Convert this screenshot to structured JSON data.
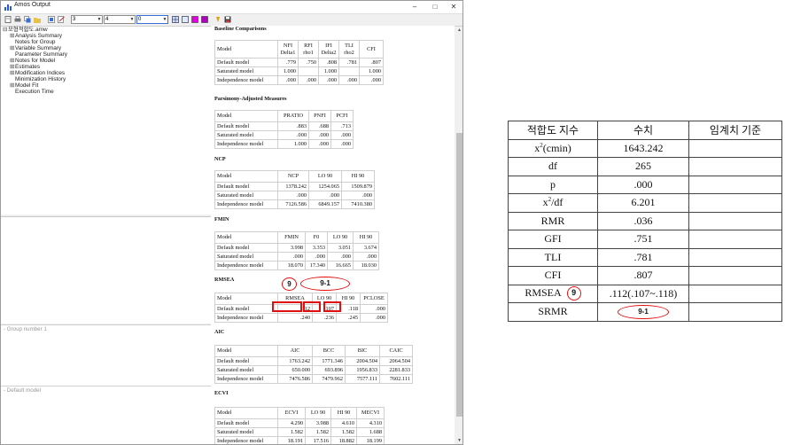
{
  "window": {
    "title": "Amos Output",
    "minimize": "–",
    "maximize": "□",
    "close": "✕"
  },
  "toolbar": {
    "combo1": "3",
    "combo2": "4",
    "combo3": "0"
  },
  "tree": {
    "root": "모형적합도.amw",
    "items": [
      "Analysis Summary",
      "Notes for Group",
      "Variable Summary",
      "Parameter Summary",
      "Notes for Model",
      "Estimates",
      "Modification Indices",
      "Minimization History",
      "Model Fit",
      "Execution Time"
    ]
  },
  "panes": {
    "group": "- Group number 1",
    "model": "- Default model"
  },
  "sections": {
    "baseline": {
      "title": "Baseline Comparisons",
      "header": [
        "Model",
        "NFI\nDelta1",
        "RFI\nrho1",
        "IFI\nDelta2",
        "TLI\nrho2",
        "CFI"
      ],
      "rows": [
        [
          "Default model",
          ".779",
          ".750",
          ".808",
          ".781",
          ".807"
        ],
        [
          "Saturated model",
          "1.000",
          "",
          "1.000",
          "",
          "1.000"
        ],
        [
          "Independence model",
          ".000",
          ".000",
          ".000",
          ".000",
          ".000"
        ]
      ]
    },
    "parsimony": {
      "title": "Parsimony-Adjusted Measures",
      "header": [
        "Model",
        "PRATIO",
        "PNFI",
        "PCFI"
      ],
      "rows": [
        [
          "Default model",
          ".883",
          ".688",
          ".713"
        ],
        [
          "Saturated model",
          ".000",
          ".000",
          ".000"
        ],
        [
          "Independence model",
          "1.000",
          ".000",
          ".000"
        ]
      ]
    },
    "ncp": {
      "title": "NCP",
      "header": [
        "Model",
        "NCP",
        "LO 90",
        "HI 90"
      ],
      "rows": [
        [
          "Default model",
          "1378.242",
          "1254.065",
          "1509.879"
        ],
        [
          "Saturated model",
          ".000",
          ".000",
          ".000"
        ],
        [
          "Independence model",
          "7126.586",
          "6849.157",
          "7410.380"
        ]
      ]
    },
    "fmin": {
      "title": "FMIN",
      "header": [
        "Model",
        "FMIN",
        "F0",
        "LO 90",
        "HI 90"
      ],
      "rows": [
        [
          "Default model",
          "3.998",
          "3.353",
          "3.051",
          "3.674"
        ],
        [
          "Saturated model",
          ".000",
          ".000",
          ".000",
          ".000"
        ],
        [
          "Independence model",
          "18.070",
          "17.340",
          "16.665",
          "18.030"
        ]
      ]
    },
    "rmsea": {
      "title": "RMSEA",
      "header": [
        "Model",
        "RMSEA",
        "LO 90",
        "HI 90",
        "PCLOSE"
      ],
      "rows": [
        [
          "Default model",
          ".112",
          ".107",
          ".118",
          ".000"
        ],
        [
          "Independence model",
          ".240",
          ".236",
          ".245",
          ".000"
        ]
      ]
    },
    "aic": {
      "title": "AIC",
      "header": [
        "Model",
        "AIC",
        "BCC",
        "BIC",
        "CAIC"
      ],
      "rows": [
        [
          "Default model",
          "1763.242",
          "1771.346",
          "2004.504",
          "2064.504"
        ],
        [
          "Saturated model",
          "650.000",
          "693.896",
          "1956.833",
          "2281.833"
        ],
        [
          "Independence model",
          "7476.586",
          "7479.962",
          "7577.111",
          "7602.111"
        ]
      ]
    },
    "ecvi": {
      "title": "ECVI",
      "header": [
        "Model",
        "ECVI",
        "LO 90",
        "HI 90",
        "MECVI"
      ],
      "rows": [
        [
          "Default model",
          "4.290",
          "3.988",
          "4.610",
          "4.310"
        ],
        [
          "Saturated model",
          "1.582",
          "1.582",
          "1.582",
          "1.688"
        ],
        [
          "Independence model",
          "18.191",
          "17.516",
          "18.882",
          "18.199"
        ]
      ]
    }
  },
  "annotations": {
    "circle_label": "9",
    "oval_label": "9-1"
  },
  "fit_table": {
    "headers": [
      "적합도 지수",
      "수치",
      "임계치 기준"
    ],
    "rows": [
      {
        "name_base": "x",
        "name_sup": "2",
        "name_rest": "(cmin)",
        "value": "1643.242"
      },
      {
        "name_base": "df",
        "name_sup": "",
        "name_rest": "",
        "value": "265"
      },
      {
        "name_base": "p",
        "name_sup": "",
        "name_rest": "",
        "value": ".000"
      },
      {
        "name_base": "x",
        "name_sup": "2",
        "name_rest": "/df",
        "value": "6.201"
      },
      {
        "name_base": "RMR",
        "name_sup": "",
        "name_rest": "",
        "value": ".036"
      },
      {
        "name_base": "GFI",
        "name_sup": "",
        "name_rest": "",
        "value": ".751"
      },
      {
        "name_base": "TLI",
        "name_sup": "",
        "name_rest": "",
        "value": ".781"
      },
      {
        "name_base": "CFI",
        "name_sup": "",
        "name_rest": "",
        "value": ".807"
      },
      {
        "name_base": "RMSEA",
        "name_sup": "",
        "name_rest": "",
        "value": ".112(.107~.118)"
      },
      {
        "name_base": "SRMR",
        "name_sup": "",
        "name_rest": "",
        "value": ""
      }
    ]
  },
  "colors": {
    "annotation_red": "#e01010",
    "magenta": "#e000e0",
    "selection_blue": "#3a6fd8"
  }
}
